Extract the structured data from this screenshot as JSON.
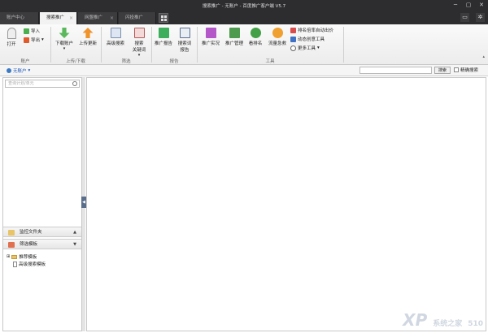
{
  "window": {
    "title": "搜索推广 - 无账户 - 百度推广客户端 V5.7"
  },
  "tabs": [
    {
      "label": "账户中心",
      "closable": false
    },
    {
      "label": "搜索推广",
      "closable": true
    },
    {
      "label": "网盟推广",
      "closable": true
    },
    {
      "label": "闪投推广",
      "closable": false
    }
  ],
  "ribbon": {
    "open": "打开",
    "import": "导入",
    "export": "导出",
    "download_account": "下载账户",
    "upload_update": "上传更新",
    "advanced_search": "高级搜索",
    "search_keyword_line1": "搜索",
    "search_keyword_line2": "关键词",
    "promo_report": "推广报告",
    "search_word_report_line1": "搜索词",
    "search_word_report_line2": "报告",
    "promo_live": "推广实况",
    "promo_manage": "推广管理",
    "look_rank": "看排名",
    "traffic_boost": "流量急救",
    "rank_auto_bid": "排名倍率自动出价",
    "dynamic_creative": "动态创意工具",
    "more_tools": "更多工具",
    "groups": {
      "account": "账户",
      "upload_download": "上传/下载",
      "filter": "筛选",
      "report": "报告",
      "tools": "工具"
    }
  },
  "account_bar": {
    "account": "无账户",
    "search_button": "搜索",
    "exact_search": "精确搜索"
  },
  "left_panel": {
    "search_placeholder": "查询计划/单元",
    "monitor_folder": "监控文件夹",
    "filter_templates": "筛选模板",
    "tree": {
      "recommended": "推荐模板",
      "advanced": "高级搜索模板"
    }
  },
  "watermark": {
    "logo": "XP",
    "site_name": "系统之家",
    "site_number": "510"
  },
  "colors": {
    "titlebar": "#2d2d30",
    "accent_blue": "#1a56b8"
  }
}
